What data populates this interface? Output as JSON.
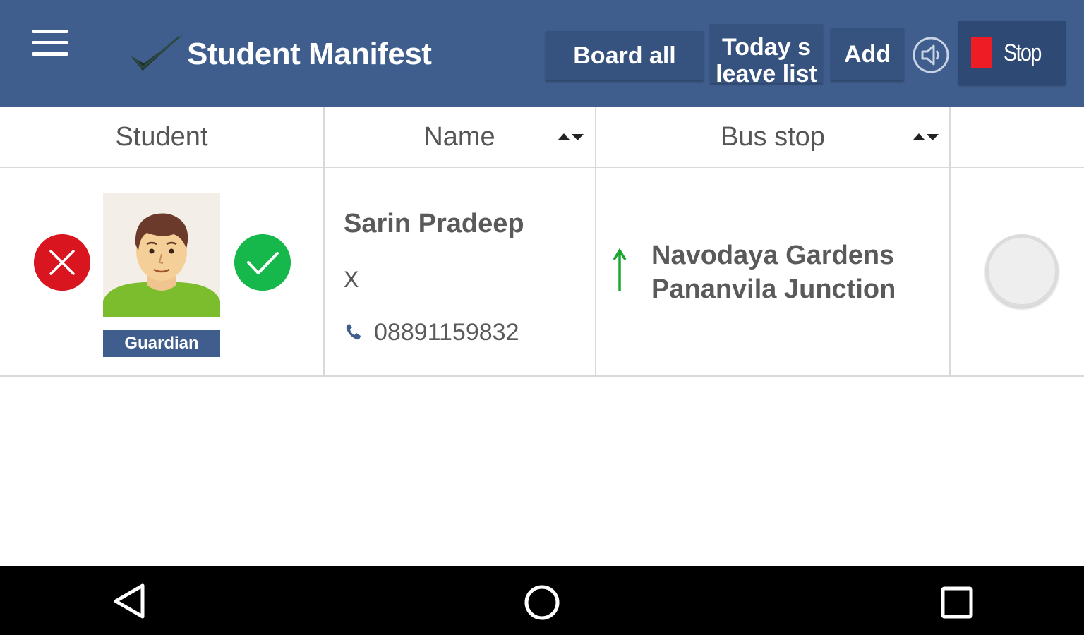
{
  "header": {
    "title": "Student Manifest",
    "menu_icon": "menu-icon",
    "logo_icon": "checkmark-logo-icon",
    "board_all_label": "Board all",
    "leave_list_label": "Today s leave list",
    "add_label": "Add",
    "speaker_icon": "speaker-icon",
    "stop_label": "Stop",
    "stop_color": "#ee1c25",
    "background_color": "#3f5d8d"
  },
  "table": {
    "columns": [
      {
        "label": "Student",
        "sortable": false
      },
      {
        "label": "Name",
        "sortable": true
      },
      {
        "label": "Bus stop",
        "sortable": true
      }
    ],
    "rows": [
      {
        "avatar_icon": "student-avatar",
        "guardian_label": "Guardian",
        "absent_icon": "close-icon",
        "present_icon": "check-icon",
        "name": "Sarin Pradeep",
        "class": "X",
        "phone": "08891159832",
        "direction_icon": "arrow-up-icon",
        "bus_stop": "Navodaya Gardens\nPananvila Junction"
      }
    ]
  },
  "navbar": {
    "back_icon": "back-icon",
    "home_icon": "home-icon",
    "recent_icon": "recent-apps-icon"
  }
}
